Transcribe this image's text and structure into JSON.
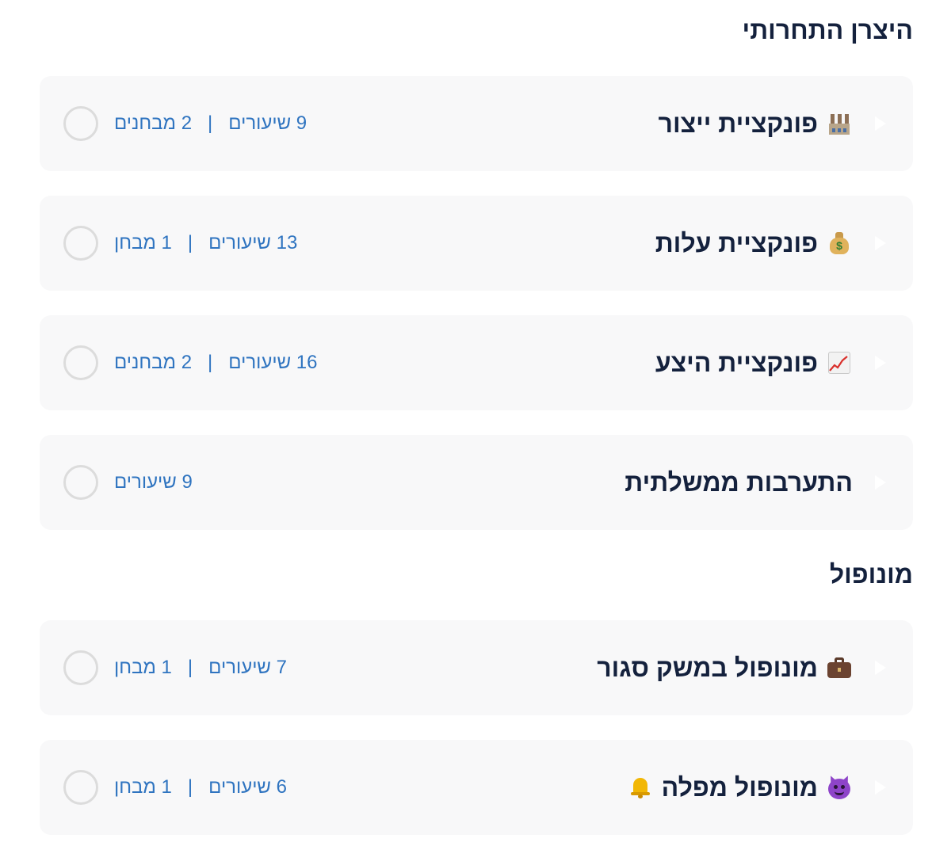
{
  "sections": [
    {
      "title": "היצרן התחרותי",
      "units": [
        {
          "icon": "factory-icon",
          "title": "פונקציית ייצור",
          "lessons": "9 שיעורים",
          "quizzes": "2 מבחנים"
        },
        {
          "icon": "money-bag-icon",
          "title": "פונקציית עלות",
          "lessons": "13 שיעורים",
          "quizzes": "1 מבחן"
        },
        {
          "icon": "chart-increasing-icon",
          "title": "פונקציית היצע",
          "lessons": "16 שיעורים",
          "quizzes": "2 מבחנים"
        },
        {
          "icon": "",
          "title": "התערבות ממשלתית",
          "lessons": "9 שיעורים",
          "quizzes": ""
        }
      ]
    },
    {
      "title": "מונופול",
      "units": [
        {
          "icon": "briefcase-icon",
          "title": "מונופול במשק סגור",
          "lessons": "7 שיעורים",
          "quizzes": "1 מבחן"
        },
        {
          "icon": "devil-face-icon",
          "icon_trailing": "bell-icon",
          "title": "מונופול מפלה",
          "lessons": "6 שיעורים",
          "quizzes": "1 מבחן"
        }
      ]
    }
  ],
  "separator": "|",
  "colors": {
    "heading": "#14213d",
    "meta_link": "#2f74c0",
    "card_bg": "#f8f8f9",
    "ring": "#dcdcdc"
  }
}
